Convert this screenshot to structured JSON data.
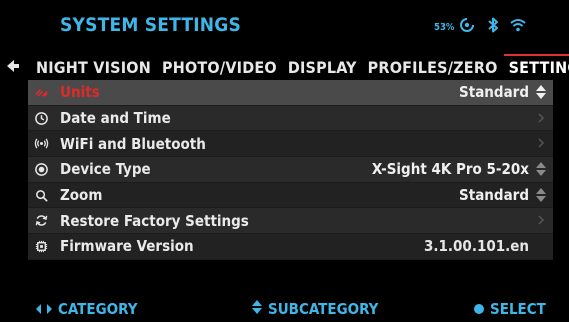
{
  "header": {
    "title": "SYSTEM SETTINGS",
    "battery_percent": "53%",
    "icons": [
      "gyro-icon",
      "bluetooth-icon",
      "wifi-icon"
    ]
  },
  "tabs": [
    {
      "label": "NIGHT VISION",
      "active": false
    },
    {
      "label": "PHOTO/VIDEO",
      "active": false
    },
    {
      "label": "DISPLAY",
      "active": false
    },
    {
      "label": "PROFILES/ZERO",
      "active": false
    },
    {
      "label": "SETTINGS",
      "active": true
    }
  ],
  "menu": {
    "rows": [
      {
        "label": "Units",
        "icon": "ruler-units-icon",
        "value": "Standard",
        "right_icon": "up-down-arrows-icon",
        "selected": true
      },
      {
        "label": "Date and Time",
        "icon": "clock-icon",
        "value": "",
        "right_icon": "chevron-right-icon",
        "selected": false
      },
      {
        "label": "WiFi and Bluetooth",
        "icon": "wireless-icon",
        "value": "",
        "right_icon": "chevron-right-icon",
        "selected": false
      },
      {
        "label": "Device Type",
        "icon": "device-target-icon",
        "value": "X-Sight 4K Pro 5-20x",
        "right_icon": "up-down-arrows-icon",
        "selected": false
      },
      {
        "label": "Zoom",
        "icon": "magnifier-icon",
        "value": "Standard",
        "right_icon": "up-down-arrows-icon",
        "selected": false
      },
      {
        "label": "Restore Factory Settings",
        "icon": "refresh-icon",
        "value": "",
        "right_icon": "chevron-right-icon",
        "selected": false
      },
      {
        "label": "Firmware Version",
        "icon": "chip-icon",
        "value": "3.1.00.101.en",
        "right_icon": "",
        "selected": false
      }
    ]
  },
  "footer": {
    "category": "CATEGORY",
    "subcategory": "SUBCATEGORY",
    "select": "SELECT"
  },
  "colors": {
    "accent": "#3fb6e8",
    "selected_text": "#e02a2a",
    "tab_active_border": "#e03030"
  }
}
